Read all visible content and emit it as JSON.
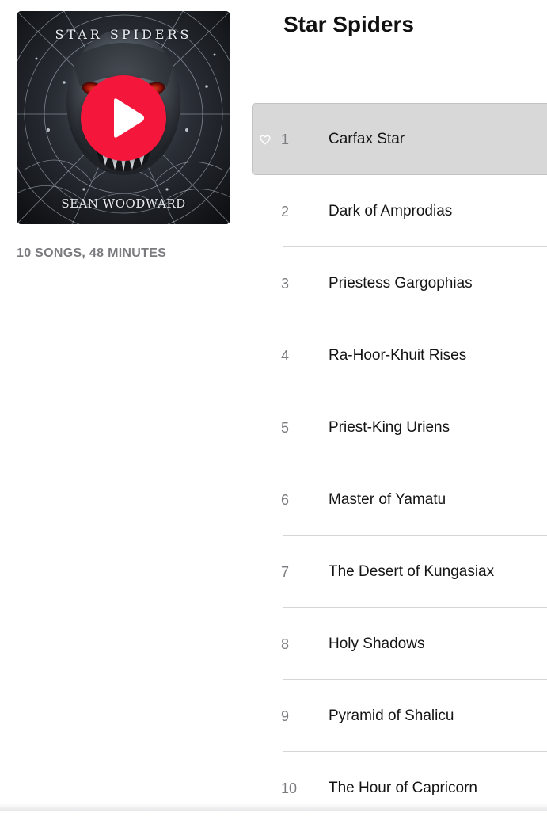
{
  "album": {
    "title": "Star Spiders",
    "meta": "10 SONGS, 48 MINUTES",
    "artwork": {
      "title_text": "STAR SPIDERS",
      "artist_text": "SEAN WOODWARD"
    },
    "play_button_color": "#f5163c"
  },
  "tracks": [
    {
      "number": "1",
      "name": "Carfax Star",
      "selected": true
    },
    {
      "number": "2",
      "name": "Dark of Amprodias"
    },
    {
      "number": "3",
      "name": "Priestess Gargophias"
    },
    {
      "number": "4",
      "name": "Ra-Hoor-Khuit Rises"
    },
    {
      "number": "5",
      "name": "Priest-King Uriens"
    },
    {
      "number": "6",
      "name": "Master of Yamatu"
    },
    {
      "number": "7",
      "name": "The Desert of Kungasiax"
    },
    {
      "number": "8",
      "name": "Holy Shadows"
    },
    {
      "number": "9",
      "name": "Pyramid of Shalicu"
    },
    {
      "number": "10",
      "name": "The Hour of Capricorn"
    }
  ],
  "icons": {
    "play": "play-icon",
    "favorite": "heart-outline-icon"
  },
  "colors": {
    "selected_row": "#d8d8d8",
    "meta_text": "#7b7b7f",
    "divider": "#d6d6d8"
  }
}
